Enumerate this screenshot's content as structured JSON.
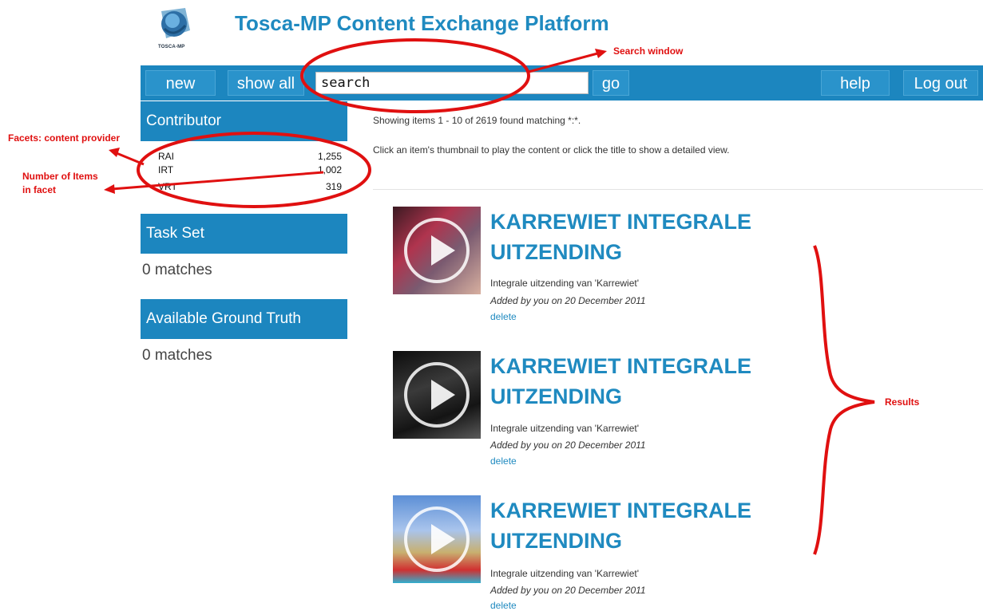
{
  "header": {
    "app_title": "Tosca-MP Content Exchange Platform",
    "logo_text": "TOSCA-MP"
  },
  "toolbar": {
    "new_label": "new",
    "show_all_label": "show all",
    "search_value": "search",
    "go_label": "go",
    "help_label": "help",
    "logout_label": "Log out"
  },
  "sidebar": {
    "contributor": {
      "title": "Contributor",
      "items": [
        {
          "label": "RAI",
          "count": "1,255"
        },
        {
          "label": "IRT",
          "count": "1,002"
        },
        {
          "label": "VRT",
          "count": "319"
        }
      ]
    },
    "task_set": {
      "title": "Task Set",
      "matches": "0 matches"
    },
    "ground_truth": {
      "title": "Available Ground Truth",
      "matches": "0 matches"
    }
  },
  "main": {
    "summary": "Showing items 1 - 10 of 2619 found matching *:*.",
    "instructions": "Click an item's thumbnail to play the content or click the title to show a detailed view.",
    "results": [
      {
        "title": "KARREWIET INTEGRALE UITZENDING",
        "description": "Integrale uitzending van 'Karrewiet'",
        "added": "Added by you on 20 December 2011",
        "delete_label": "delete"
      },
      {
        "title": "KARREWIET INTEGRALE UITZENDING",
        "description": "Integrale uitzending van 'Karrewiet'",
        "added": "Added by you on 20 December 2011",
        "delete_label": "delete"
      },
      {
        "title": "KARREWIET INTEGRALE UITZENDING",
        "description": "Integrale uitzending van 'Karrewiet'",
        "added": "Added by you on 20 December 2011",
        "delete_label": "delete"
      }
    ]
  },
  "annotations": {
    "search_window": "Search window",
    "facets": "Facets: content provider",
    "number_items": [
      "Number of Items",
      "in facet"
    ],
    "results": "Results"
  },
  "colors": {
    "accent": "#1c86bf",
    "title_blue": "#1f8ac0",
    "annotation_red": "#e01010"
  }
}
